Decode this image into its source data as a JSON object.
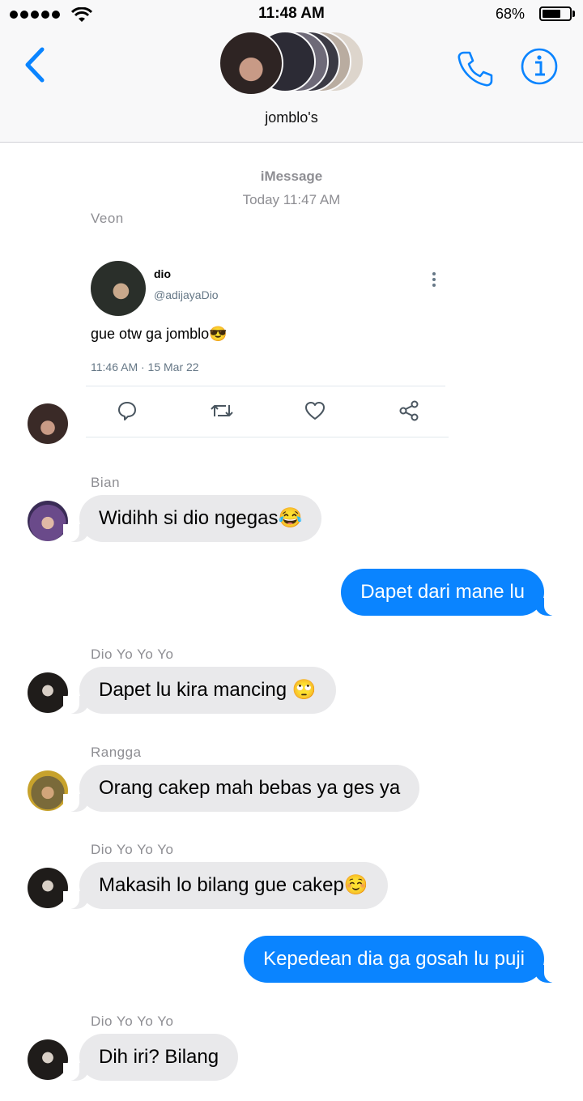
{
  "status_bar": {
    "time": "11:48 AM",
    "battery_percent": "68%",
    "battery_level": 0.68
  },
  "header": {
    "group_name": "jomblo's",
    "icons": [
      "chevron-left-icon",
      "phone-icon",
      "info-icon"
    ]
  },
  "conversation": {
    "service": "iMessage",
    "timestamp": "Today 11:47 AM",
    "tweet": {
      "sender": "Veon",
      "name": "dio",
      "handle": "@adijayaDio",
      "text": "gue otw ga jomblo😎",
      "time": "11:46 AM · 15 Mar 22",
      "actions": [
        "reply-icon",
        "retweet-icon",
        "like-icon",
        "share-icon"
      ]
    },
    "messages": [
      {
        "sender": "Bian",
        "text": "Widihh si dio ngegas😂",
        "direction": "incoming"
      },
      {
        "text": "Dapet dari mane lu",
        "direction": "outgoing"
      },
      {
        "sender": "Dio Yo Yo Yo",
        "text": "Dapet lu kira mancing 🙄",
        "direction": "incoming"
      },
      {
        "sender": "Rangga",
        "text": "Orang cakep mah bebas ya ges ya",
        "direction": "incoming"
      },
      {
        "sender": "Dio Yo Yo Yo",
        "text": "Makasih lo bilang gue cakep☺️",
        "direction": "incoming"
      },
      {
        "text": "Kepedean dia ga gosah lu puji",
        "direction": "outgoing"
      },
      {
        "sender": "Dio Yo Yo Yo",
        "text": "Dih iri? Bilang",
        "direction": "incoming"
      }
    ]
  },
  "colors": {
    "accent": "#0a84ff",
    "incoming_bubble": "#e9e9eb",
    "header_bg": "#f8f8f9",
    "meta_text": "#8e8e93"
  }
}
